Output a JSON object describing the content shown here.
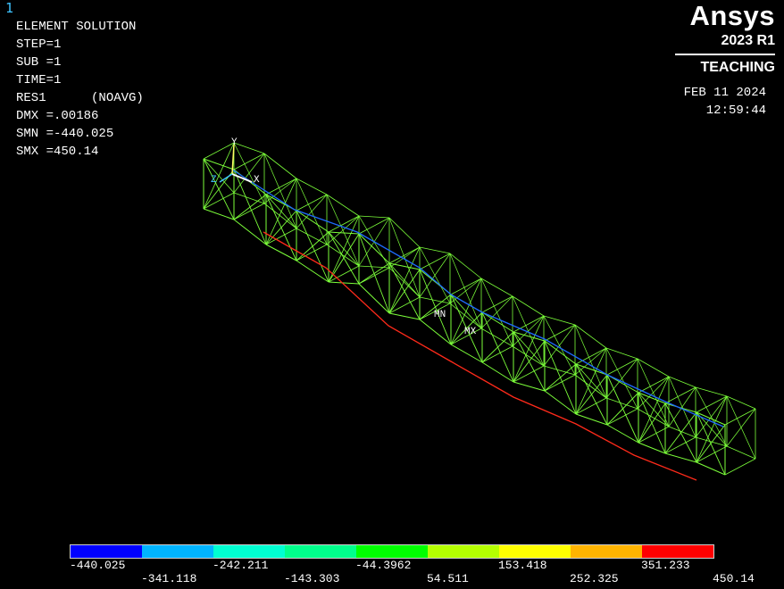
{
  "window_number": "1",
  "info_lines": [
    "ELEMENT SOLUTION",
    "",
    "STEP=1",
    "SUB =1",
    "TIME=1",
    "RES1      (NOAVG)",
    "DMX =.00186",
    "SMN =-440.025",
    "SMX =450.14"
  ],
  "brand": {
    "name": "Ansys",
    "version": "2023 R1",
    "edition": "TEACHING"
  },
  "datetime": {
    "date": "FEB 11 2024",
    "time": "12:59:44"
  },
  "markers": {
    "min": "MN",
    "max": "MX"
  },
  "triad": {
    "x": "X",
    "y": "Y",
    "z": "Z"
  },
  "legend": {
    "colors": [
      "#0000ff",
      "#00b4ff",
      "#00ffd2",
      "#00ff8c",
      "#00ff00",
      "#b4ff00",
      "#ffff00",
      "#ffb400",
      "#ff0000"
    ],
    "upper_labels": [
      "-440.025",
      "-242.211",
      "-44.3962",
      "153.418",
      "351.233"
    ],
    "lower_labels": [
      "-341.118",
      "-143.303",
      "54.511",
      "252.325",
      "450.14"
    ]
  },
  "colors": {
    "mesh": "#7cff3a",
    "top_edge": "#1e6bff",
    "bottom_edge": "#ff2a1a"
  }
}
